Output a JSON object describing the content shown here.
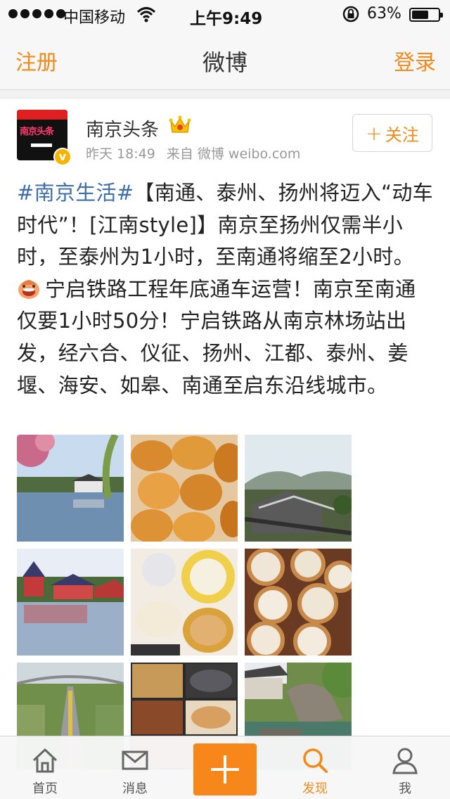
{
  "status_bar": {
    "carrier": "中国移动",
    "time": "上午9:49",
    "battery_percent": "63%",
    "battery_level": 0.63,
    "signal_bars": 5
  },
  "nav": {
    "left_label": "注册",
    "title": "微博",
    "right_label": "登录"
  },
  "post": {
    "author": "南京头条",
    "avatar_text": "南京头条",
    "time": "昨天 18:49",
    "source": "来自 微博 weibo.com",
    "follow_label": "关注",
    "hashtag": "#南京生活#",
    "text_part1": "【南通、泰州、扬州将迈入“动车时代”！[江南style]】南京至扬州仅需半小时，至泰州为1小时，至南通将缩至2小时。",
    "text_part2": "宁启铁路工程年底通车运营！南京至南通仅要1小时50分！宁启铁路从南京林场站出发，经六合、仪征、扬州、江都、泰州、姜堰、海安、如皋、南通至启东沿线城市。",
    "images": [
      "garden-pavilion-lake",
      "fried-cakes",
      "old-town-rooftops",
      "pavilion-on-water",
      "noodles-and-buns",
      "steamed-dumplings",
      "highway-bridge",
      "dishes-collage",
      "water-garden"
    ]
  },
  "tab_bar": {
    "items": [
      {
        "label": "首页",
        "icon": "home-icon"
      },
      {
        "label": "消息",
        "icon": "mail-icon"
      },
      {
        "label": "",
        "icon": "plus-icon"
      },
      {
        "label": "发现",
        "icon": "search-icon"
      },
      {
        "label": "我",
        "icon": "person-icon"
      }
    ],
    "active_index": 3
  },
  "colors": {
    "accent": "#f08a1c",
    "hashtag": "#3d6ea7",
    "meta": "#999999"
  }
}
